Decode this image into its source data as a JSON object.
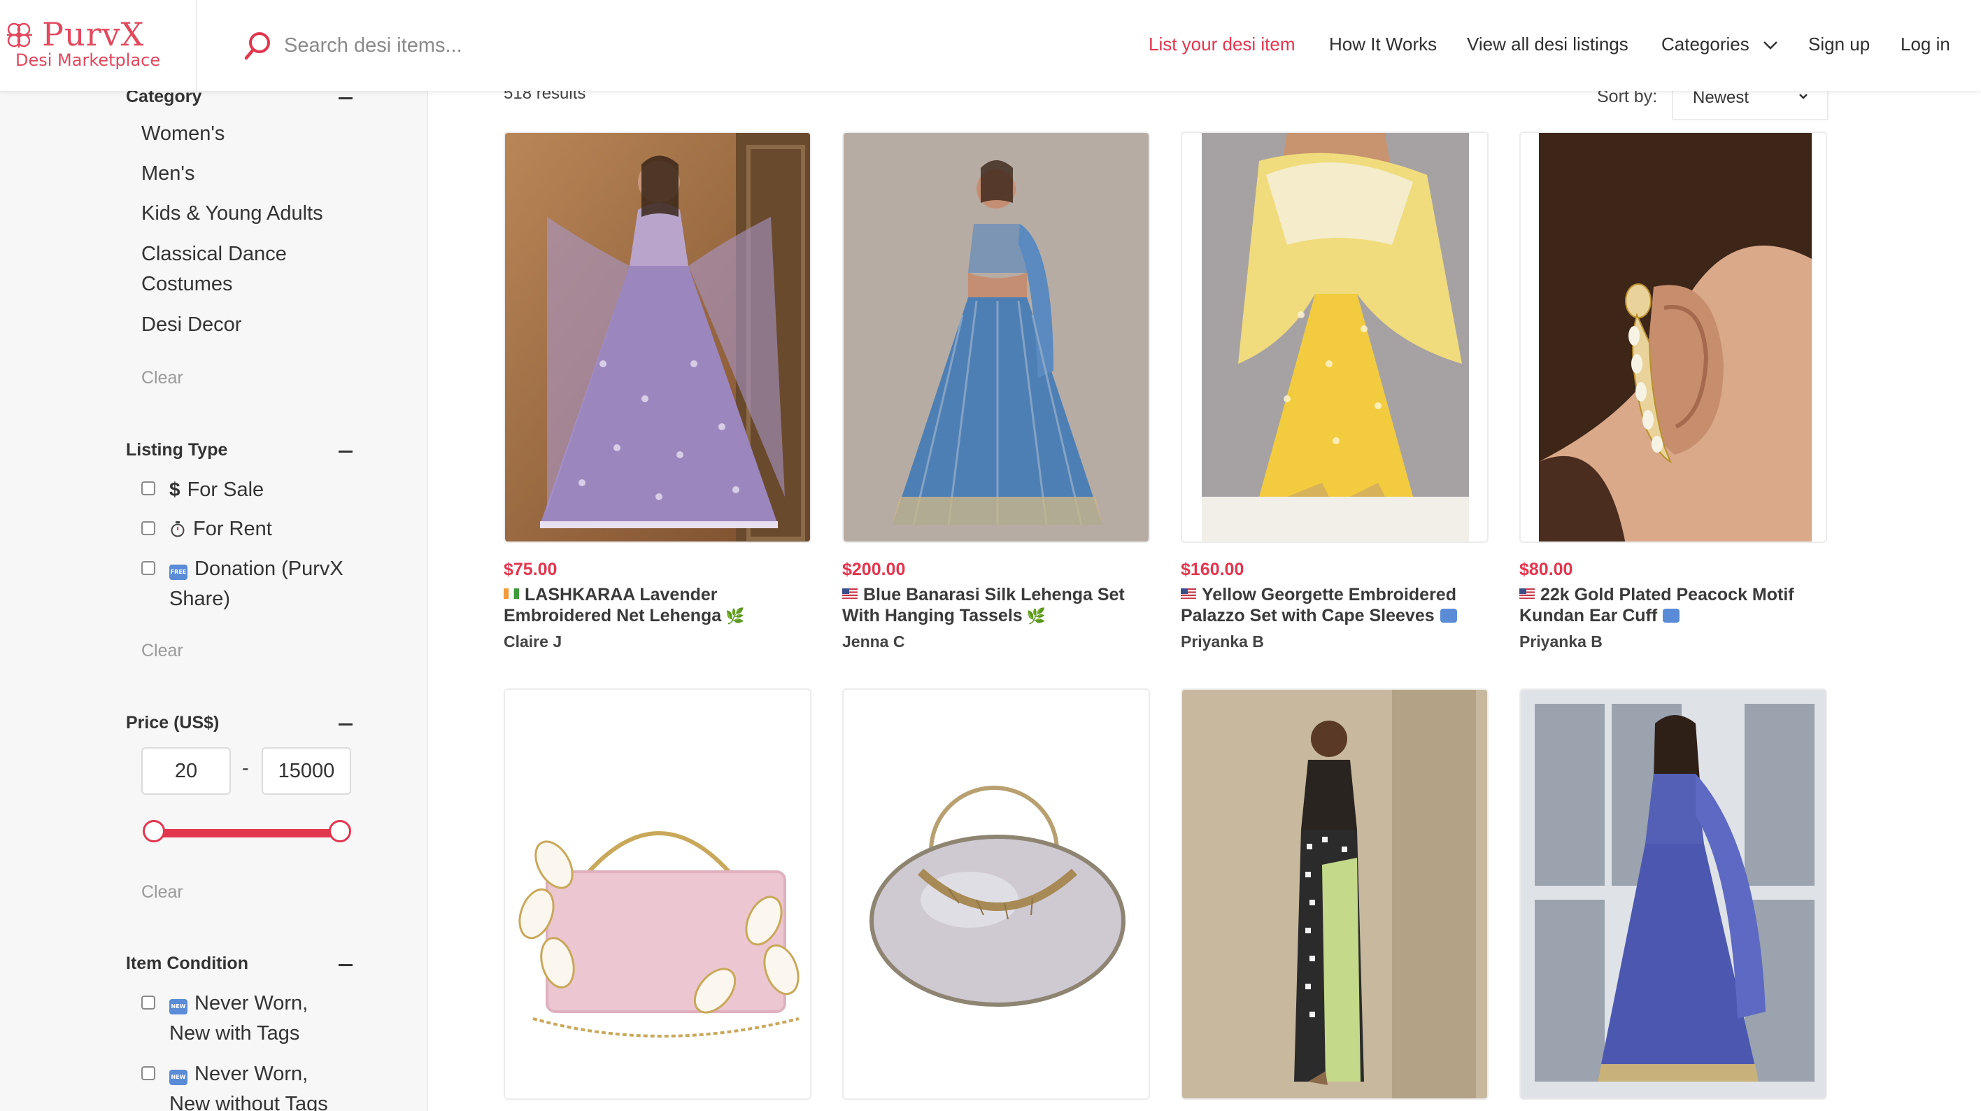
{
  "header": {
    "logo_name": "PurvX",
    "logo_tagline": "Desi Marketplace",
    "search_placeholder": "Search desi items...",
    "nav": {
      "list_item": "List your desi item",
      "how_it_works": "How It Works",
      "view_all": "View all desi listings",
      "categories": "Categories",
      "sign_up": "Sign up",
      "log_in": "Log in"
    },
    "colors": {
      "brand": "#e2364f"
    }
  },
  "sidebar": {
    "category": {
      "heading": "Category",
      "items": [
        "Women's",
        "Men's",
        "Kids & Young Adults",
        "Classical Dance Costumes",
        "Desi Decor"
      ],
      "clear": "Clear"
    },
    "listing_type": {
      "heading": "Listing Type",
      "options": [
        "For Sale",
        "For Rent",
        "Donation (PurvX Share)"
      ],
      "clear": "Clear"
    },
    "price": {
      "heading": "Price (US$)",
      "min": "20",
      "max": "15000",
      "separator": "-",
      "clear": "Clear"
    },
    "item_condition": {
      "heading": "Item Condition",
      "options": [
        "Never Worn, New with Tags",
        "Never Worn, New without Tags"
      ]
    }
  },
  "results": {
    "count": "518 results",
    "sort_label": "Sort by:",
    "sort_value": "Newest"
  },
  "listings": [
    {
      "price": "$75.00",
      "title": "LASHKARAA Lavender Embroidered Net Lehenga",
      "seller": "Claire J",
      "flag": "india-flag-icon"
    },
    {
      "price": "$200.00",
      "title": "Blue Banarasi Silk Lehenga Set With Hanging Tassels",
      "seller": "Jenna C",
      "flag": "us-flag-icon"
    },
    {
      "price": "$160.00",
      "title": "Yellow Georgette Embroidered Palazzo Set with Cape Sleeves",
      "seller": "Priyanka B",
      "flag": "us-flag-icon"
    },
    {
      "price": "$80.00",
      "title": "22k Gold Plated Peacock Motif Kundan Ear Cuff",
      "seller": "Priyanka B",
      "flag": "us-flag-icon"
    }
  ]
}
